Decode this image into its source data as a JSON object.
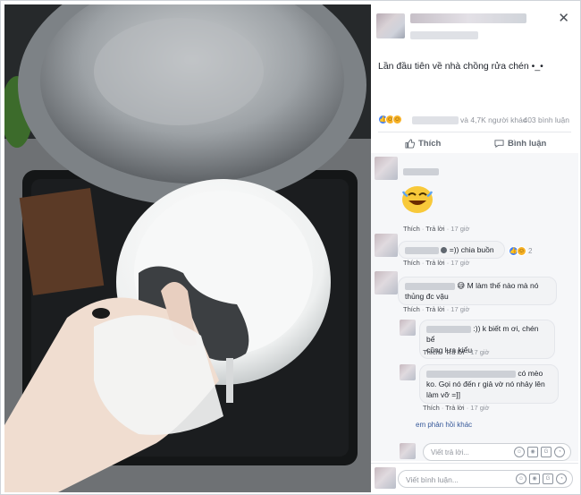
{
  "post": {
    "caption": "Lần đầu tiên về nhà chồng rửa chén •_•",
    "reactions_others": "và 4,7K người khác",
    "comment_count": "403 bình luận"
  },
  "actions": {
    "like_label": "Thích",
    "comment_label": "Bình luận"
  },
  "comments": [
    {
      "time": "17 giờ",
      "like_label": "Thích",
      "reply_label": "Trả lời"
    },
    {
      "text": "=)) chia buồn",
      "reaction_count": "2",
      "time": "17 giờ",
      "like_label": "Thích",
      "reply_label": "Trả lời"
    },
    {
      "text_line1": "M làm thế nào mà nó",
      "text_line2": "thủng đc vậu",
      "time": "17 giờ",
      "like_label": "Thích",
      "reply_label": "Trả lời"
    }
  ],
  "replies": [
    {
      "text_line1": ":)) k biết m ơi, chén bể",
      "text_line2": "cũng lựa kiểu",
      "time": "17 giờ",
      "like_label": "Thích",
      "reply_label": "Trả lời"
    },
    {
      "text_line1": "có mèo",
      "text_line2": "ko. Gọi nó đến r giả vờ nó nhảy lên",
      "text_line3": "làm vỡ =]]",
      "time": "17 giờ",
      "like_label": "Thích",
      "reply_label": "Trả lời"
    }
  ],
  "more_replies": "em phản hồi khác",
  "reply_placeholder": "Viết trả lời...",
  "comment_placeholder": "Viết bình luận...",
  "icons": [
    "close-icon",
    "like-icon",
    "comment-icon",
    "haha-reaction-icon",
    "like-reaction-icon",
    "smile-icon",
    "camera-icon",
    "gif-icon",
    "sticker-icon"
  ],
  "colors": {
    "link": "#365899",
    "meta": "#90949c",
    "like_blue": "#4080ff"
  }
}
